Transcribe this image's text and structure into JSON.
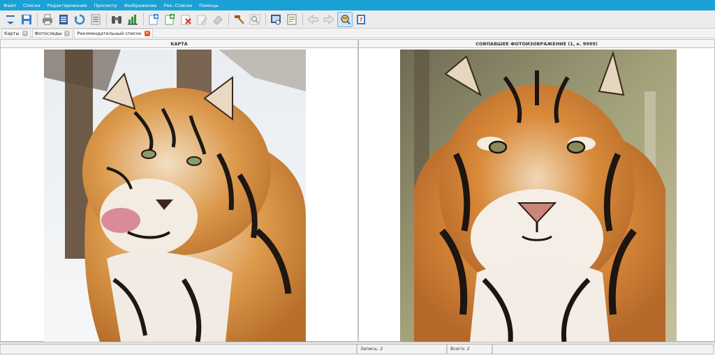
{
  "menu": {
    "items": [
      "Файл",
      "Списки",
      "Редактирование",
      "Просмотр",
      "Изображение",
      "Рек. Списки",
      "Помощь"
    ]
  },
  "toolbar": {
    "buttons": [
      {
        "icon": "menu-dropdown-icon"
      },
      {
        "icon": "save-icon"
      },
      {
        "icon": "print-icon"
      },
      {
        "icon": "document-view-icon"
      },
      {
        "icon": "refresh-icon"
      },
      {
        "icon": "list-icon"
      },
      {
        "icon": "binoculars-icon"
      },
      {
        "icon": "chart-icon"
      },
      {
        "icon": "add-record-icon"
      },
      {
        "icon": "add-photo-icon"
      },
      {
        "icon": "delete-icon"
      },
      {
        "icon": "edit-icon"
      },
      {
        "icon": "eraser-icon"
      },
      {
        "icon": "hammer-icon"
      },
      {
        "icon": "zoom-icon"
      },
      {
        "icon": "compare-icon"
      },
      {
        "icon": "notes-icon"
      },
      {
        "icon": "back-arrow-icon"
      },
      {
        "icon": "forward-arrow-icon"
      },
      {
        "icon": "match-search-icon",
        "active": true
      },
      {
        "icon": "help-icon"
      }
    ]
  },
  "tabs": [
    {
      "label": "Карты",
      "active": false
    },
    {
      "label": "Фотоследы",
      "active": false
    },
    {
      "label": "Рекомендательный список",
      "active": true
    }
  ],
  "left_panel": {
    "header": "КАРТА"
  },
  "right_panel": {
    "header": "СОВПАВШЕЕ ФОТОИЗОБРАЖЕНИЕ (1, к. 9999)"
  },
  "status": {
    "record": "Запись: 2",
    "total": "Всего: 2"
  },
  "colors": {
    "menubar": "#1aa1d6",
    "active_tab_close": "#e8552d",
    "tiger_orange": "#d98a3a"
  }
}
